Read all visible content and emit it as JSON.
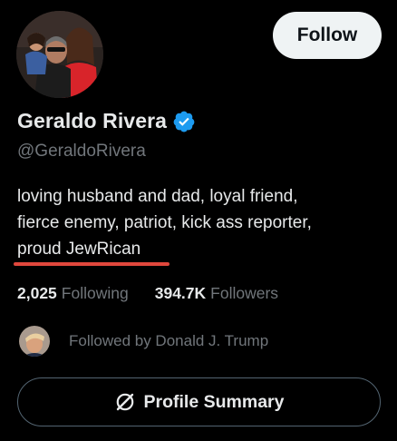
{
  "profile": {
    "display_name": "Geraldo Rivera",
    "handle": "@GeraldoRivera",
    "verified_color": "#1d9bf0",
    "bio_lines": [
      "loving husband and dad, loyal friend,",
      "fierce enemy, patriot, kick ass reporter,",
      "proud JewRican"
    ]
  },
  "actions": {
    "follow_label": "Follow",
    "summary_label": "Profile Summary",
    "summary_icon": "grok-icon"
  },
  "stats": {
    "following_count": "2,025",
    "following_label": "Following",
    "followers_count": "394.7K",
    "followers_label": "Followers"
  },
  "followed_by": {
    "text": "Followed by Donald J. Trump"
  },
  "annotation": {
    "underline_color": "#e0473c"
  },
  "theme": {
    "background": "#000000",
    "text_primary": "#e7e9ea",
    "text_secondary": "#71767b",
    "border": "#536471"
  }
}
